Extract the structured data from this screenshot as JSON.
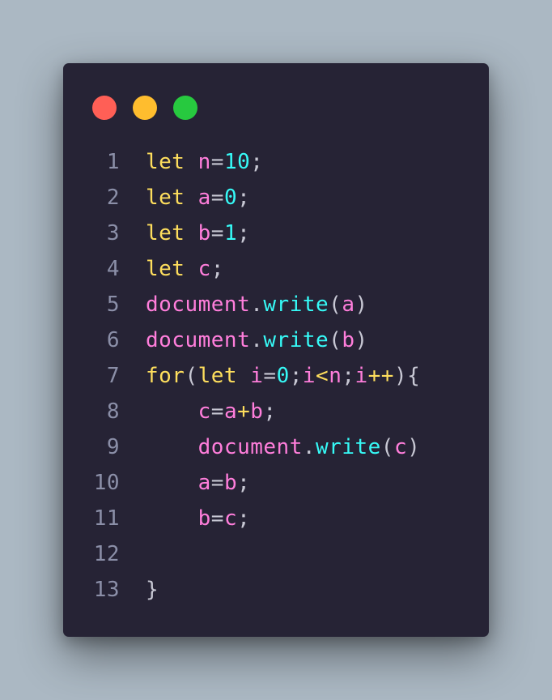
{
  "window": {
    "buttons": [
      {
        "name": "close",
        "color": "#ff5f56"
      },
      {
        "name": "minimize",
        "color": "#ffbd2e"
      },
      {
        "name": "maximize",
        "color": "#27c93f"
      }
    ]
  },
  "colors": {
    "background": "#abb8c3",
    "editor": "#262335",
    "keyword": "#fede5d",
    "variable": "#ff7edb",
    "number": "#36f9f6",
    "function": "#36f9f6",
    "punctuation": "#c8c8d4",
    "line_number": "#8b8fa8"
  },
  "code": {
    "lines": [
      {
        "number": "1",
        "tokens": [
          {
            "t": "let",
            "c": "kw"
          },
          {
            "t": " ",
            "c": "p"
          },
          {
            "t": "n",
            "c": "var"
          },
          {
            "t": "=",
            "c": "p"
          },
          {
            "t": "10",
            "c": "num"
          },
          {
            "t": ";",
            "c": "p"
          }
        ]
      },
      {
        "number": "2",
        "tokens": [
          {
            "t": "let",
            "c": "kw"
          },
          {
            "t": " ",
            "c": "p"
          },
          {
            "t": "a",
            "c": "var"
          },
          {
            "t": "=",
            "c": "p"
          },
          {
            "t": "0",
            "c": "num"
          },
          {
            "t": ";",
            "c": "p"
          }
        ]
      },
      {
        "number": "3",
        "tokens": [
          {
            "t": "let",
            "c": "kw"
          },
          {
            "t": " ",
            "c": "p"
          },
          {
            "t": "b",
            "c": "var"
          },
          {
            "t": "=",
            "c": "p"
          },
          {
            "t": "1",
            "c": "num"
          },
          {
            "t": ";",
            "c": "p"
          }
        ]
      },
      {
        "number": "4",
        "tokens": [
          {
            "t": "let",
            "c": "kw"
          },
          {
            "t": " ",
            "c": "p"
          },
          {
            "t": "c",
            "c": "var"
          },
          {
            "t": ";",
            "c": "p"
          }
        ]
      },
      {
        "number": "5",
        "tokens": [
          {
            "t": "document",
            "c": "var"
          },
          {
            "t": ".",
            "c": "p"
          },
          {
            "t": "write",
            "c": "fn"
          },
          {
            "t": "(",
            "c": "p"
          },
          {
            "t": "a",
            "c": "var"
          },
          {
            "t": ")",
            "c": "p"
          }
        ]
      },
      {
        "number": "6",
        "tokens": [
          {
            "t": "document",
            "c": "var"
          },
          {
            "t": ".",
            "c": "p"
          },
          {
            "t": "write",
            "c": "fn"
          },
          {
            "t": "(",
            "c": "p"
          },
          {
            "t": "b",
            "c": "var"
          },
          {
            "t": ")",
            "c": "p"
          }
        ]
      },
      {
        "number": "7",
        "tokens": [
          {
            "t": "for",
            "c": "kw"
          },
          {
            "t": "(",
            "c": "p"
          },
          {
            "t": "let",
            "c": "kw"
          },
          {
            "t": " ",
            "c": "p"
          },
          {
            "t": "i",
            "c": "var"
          },
          {
            "t": "=",
            "c": "p"
          },
          {
            "t": "0",
            "c": "num"
          },
          {
            "t": ";",
            "c": "p"
          },
          {
            "t": "i",
            "c": "var"
          },
          {
            "t": "<",
            "c": "kw"
          },
          {
            "t": "n",
            "c": "var"
          },
          {
            "t": ";",
            "c": "p"
          },
          {
            "t": "i",
            "c": "var"
          },
          {
            "t": "++",
            "c": "kw"
          },
          {
            "t": "){",
            "c": "p"
          }
        ]
      },
      {
        "number": "8",
        "tokens": [
          {
            "t": "    ",
            "c": "p"
          },
          {
            "t": "c",
            "c": "var"
          },
          {
            "t": "=",
            "c": "p"
          },
          {
            "t": "a",
            "c": "var"
          },
          {
            "t": "+",
            "c": "kw"
          },
          {
            "t": "b",
            "c": "var"
          },
          {
            "t": ";",
            "c": "p"
          }
        ]
      },
      {
        "number": "9",
        "tokens": [
          {
            "t": "    ",
            "c": "p"
          },
          {
            "t": "document",
            "c": "var"
          },
          {
            "t": ".",
            "c": "p"
          },
          {
            "t": "write",
            "c": "fn"
          },
          {
            "t": "(",
            "c": "p"
          },
          {
            "t": "c",
            "c": "var"
          },
          {
            "t": ")",
            "c": "p"
          }
        ]
      },
      {
        "number": "10",
        "tokens": [
          {
            "t": "    ",
            "c": "p"
          },
          {
            "t": "a",
            "c": "var"
          },
          {
            "t": "=",
            "c": "p"
          },
          {
            "t": "b",
            "c": "var"
          },
          {
            "t": ";",
            "c": "p"
          }
        ]
      },
      {
        "number": "11",
        "tokens": [
          {
            "t": "    ",
            "c": "p"
          },
          {
            "t": "b",
            "c": "var"
          },
          {
            "t": "=",
            "c": "p"
          },
          {
            "t": "c",
            "c": "var"
          },
          {
            "t": ";",
            "c": "p"
          }
        ]
      },
      {
        "number": "12",
        "tokens": []
      },
      {
        "number": "13",
        "tokens": [
          {
            "t": "}",
            "c": "p"
          }
        ]
      }
    ]
  }
}
